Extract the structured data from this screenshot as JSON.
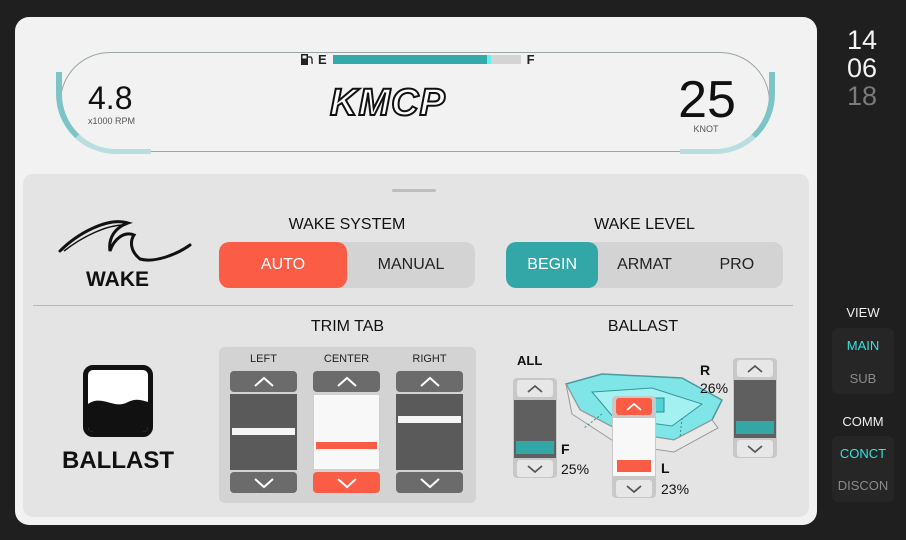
{
  "dashboard": {
    "fuel": {
      "empty_label": "E",
      "full_label": "F",
      "level_pct": 84
    },
    "rpm": {
      "value": "4.8",
      "unit": "x1000 RPM"
    },
    "brand": "KMCP",
    "speed": {
      "value": "25",
      "unit": "KNOT"
    }
  },
  "wake": {
    "label": "WAKE",
    "system": {
      "title": "WAKE SYSTEM",
      "options": [
        "AUTO",
        "MANUAL"
      ],
      "selected": "AUTO"
    },
    "level": {
      "title": "WAKE LEVEL",
      "options": [
        "BEGIN",
        "ARMAT",
        "PRO"
      ],
      "selected": "BEGIN"
    }
  },
  "ballast_section": {
    "label": "BALLAST"
  },
  "trim_tab": {
    "title": "TRIM TAB",
    "columns": [
      {
        "label": "LEFT",
        "level": 0.5
      },
      {
        "label": "CENTER",
        "level": 0.3
      },
      {
        "label": "RIGHT",
        "level": 0.6
      }
    ]
  },
  "ballast": {
    "title": "BALLAST",
    "all_label": "ALL",
    "tanks": [
      {
        "name": "F",
        "percent": "25%",
        "level": 0.25
      },
      {
        "name": "L",
        "percent": "23%",
        "level": 0.23
      },
      {
        "name": "R",
        "percent": "26%",
        "level": 0.26
      }
    ]
  },
  "clock": {
    "hour": "14",
    "minute": "06",
    "second": "18"
  },
  "view": {
    "label": "VIEW",
    "options": [
      "MAIN",
      "SUB"
    ],
    "selected": "MAIN"
  },
  "comm": {
    "label": "COMM",
    "options": [
      "CONCT",
      "DISCON"
    ],
    "selected": "CONCT"
  },
  "colors": {
    "accent_teal": "#33a7a8",
    "accent_red": "#fa5c45",
    "highlight_cyan": "#35e2dd"
  }
}
